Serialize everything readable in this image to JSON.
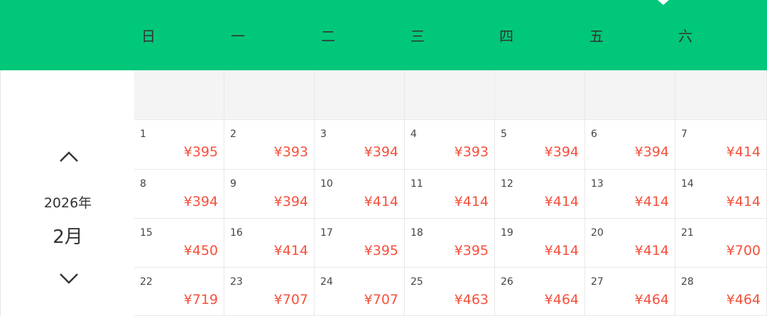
{
  "weekdays": [
    "日",
    "一",
    "二",
    "三",
    "四",
    "五",
    "六"
  ],
  "nav": {
    "year": "2026年",
    "month": "2月"
  },
  "colors": {
    "header": "#00c77a",
    "price": "#f5503c",
    "blank_cell": "#f4f4f4"
  },
  "weeks": [
    [
      null,
      null,
      null,
      null,
      null,
      null,
      null
    ],
    [
      {
        "day": "1",
        "price": "¥395"
      },
      {
        "day": "2",
        "price": "¥393"
      },
      {
        "day": "3",
        "price": "¥394"
      },
      {
        "day": "4",
        "price": "¥393"
      },
      {
        "day": "5",
        "price": "¥394"
      },
      {
        "day": "6",
        "price": "¥394"
      },
      {
        "day": "7",
        "price": "¥414"
      }
    ],
    [
      {
        "day": "8",
        "price": "¥394"
      },
      {
        "day": "9",
        "price": "¥394"
      },
      {
        "day": "10",
        "price": "¥414"
      },
      {
        "day": "11",
        "price": "¥414"
      },
      {
        "day": "12",
        "price": "¥414"
      },
      {
        "day": "13",
        "price": "¥414"
      },
      {
        "day": "14",
        "price": "¥414"
      }
    ],
    [
      {
        "day": "15",
        "price": "¥450"
      },
      {
        "day": "16",
        "price": "¥414"
      },
      {
        "day": "17",
        "price": "¥395"
      },
      {
        "day": "18",
        "price": "¥395"
      },
      {
        "day": "19",
        "price": "¥414"
      },
      {
        "day": "20",
        "price": "¥414"
      },
      {
        "day": "21",
        "price": "¥700"
      }
    ],
    [
      {
        "day": "22",
        "price": "¥719"
      },
      {
        "day": "23",
        "price": "¥707"
      },
      {
        "day": "24",
        "price": "¥707"
      },
      {
        "day": "25",
        "price": "¥463"
      },
      {
        "day": "26",
        "price": "¥464"
      },
      {
        "day": "27",
        "price": "¥464"
      },
      {
        "day": "28",
        "price": "¥464"
      }
    ]
  ]
}
